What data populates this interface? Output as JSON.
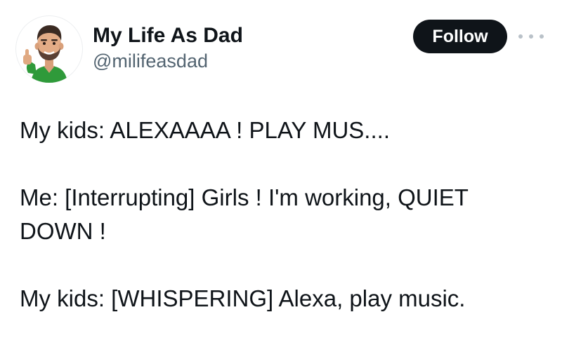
{
  "author": {
    "display_name": "My Life As Dad",
    "handle": "@milifeasdad",
    "avatar_icon": "bitmoji-dad-avatar-icon"
  },
  "actions": {
    "follow_label": "Follow",
    "more_icon": "more-horizontal-icon"
  },
  "tweet": {
    "line1": "My kids: ALEXAAAA ! PLAY MUS....",
    "line2": "Me: [Interrupting] Girls ! I'm working, QUIET",
    "line3": "DOWN !",
    "line4": "My kids: [WHISPERING] Alexa, play music."
  },
  "colors": {
    "text": "#0f1419",
    "secondary_text": "#536471",
    "follow_bg": "#0f1419",
    "follow_text": "#ffffff",
    "avatar_shirt": "#2f9a3a"
  }
}
